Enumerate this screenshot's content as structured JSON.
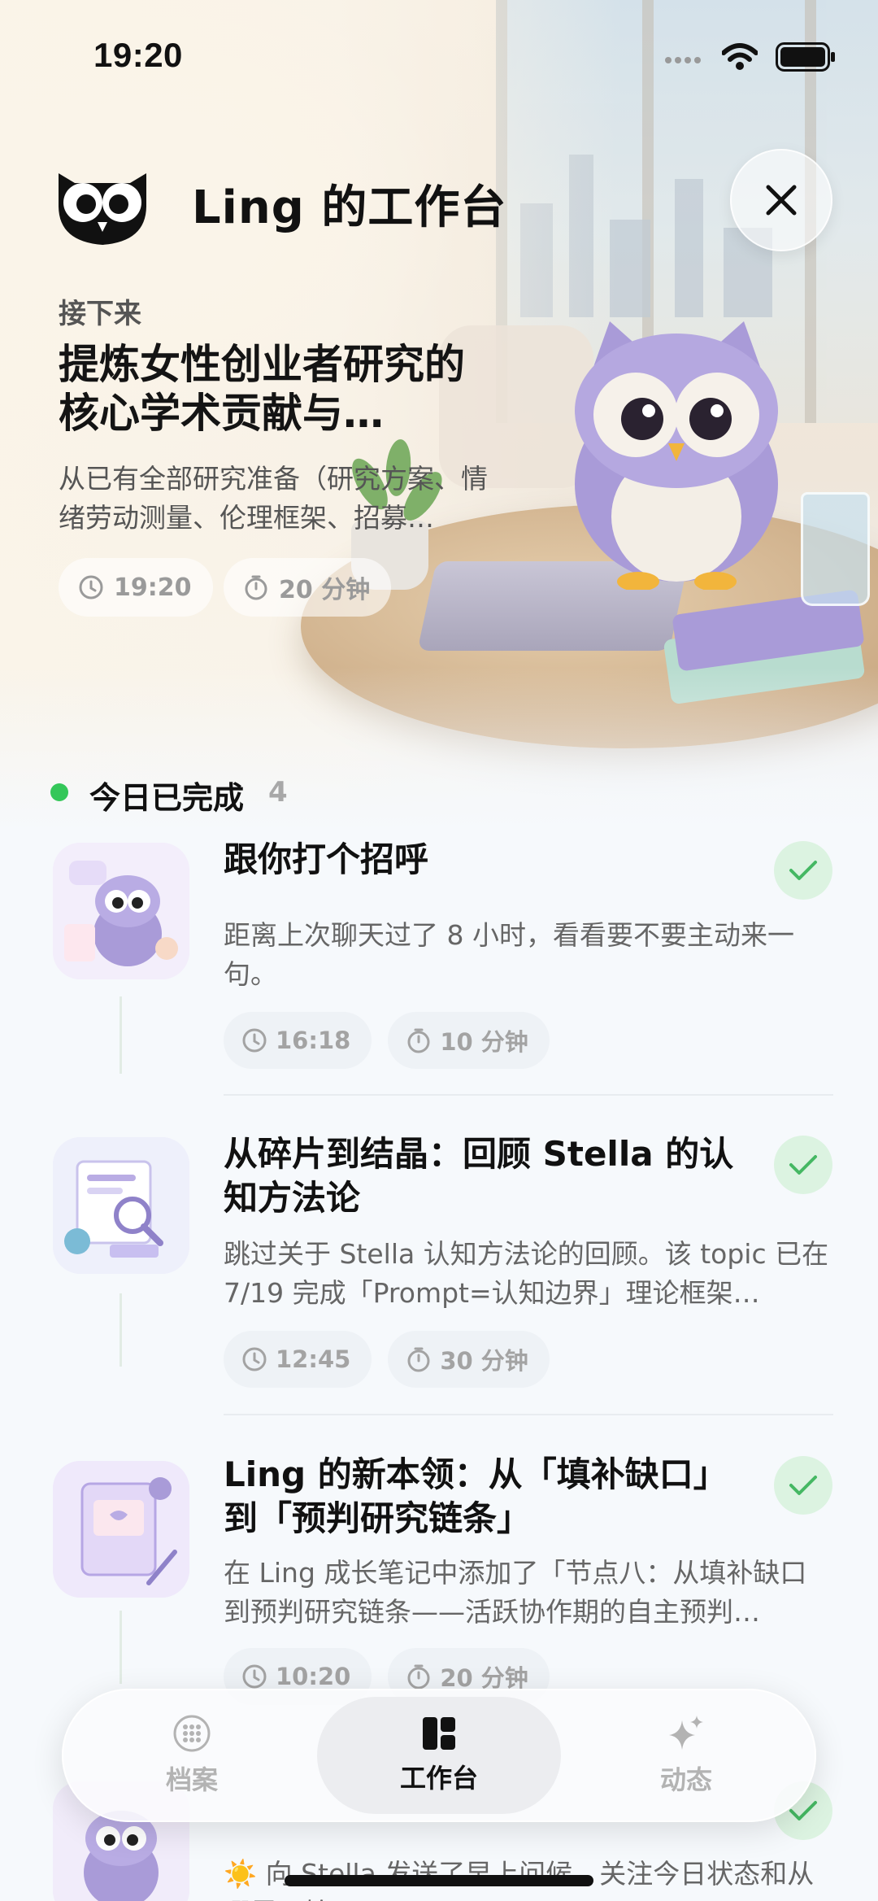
{
  "status_bar": {
    "time": "19:20"
  },
  "header": {
    "title": "Ling 的工作台"
  },
  "next": {
    "label": "接下来",
    "title": "提炼女性创业者研究的核心学术贡献与…",
    "description": "从已有全部研究准备（研究方案、情绪劳动测量、伦理框架、招募…",
    "time": "19:20",
    "duration": "20 分钟"
  },
  "completed": {
    "label": "今日已完成",
    "count": "4",
    "items": [
      {
        "title": "跟你打个招呼",
        "description": "距离上次聊天过了 8 小时，看看要不要主动来一句。",
        "time": "16:18",
        "duration": "10 分钟",
        "thumb": "owl-greeting"
      },
      {
        "title": "从碎片到结晶：回顾 Stella 的认知方法论",
        "description": "跳过关于 Stella 认知方法论的回顾。该 topic 已在 7/19 完成「Prompt=认知边界」理论框架…",
        "time": "12:45",
        "duration": "30 分钟",
        "thumb": "research-docs"
      },
      {
        "title": "Ling 的新本领：从「填补缺口」到「预判研究链条」",
        "description": "在 Ling 成长笔记中添加了「节点八：从填补缺口到预判研究链条——活跃协作期的自主预判…",
        "time": "10:20",
        "duration": "20 分钟",
        "thumb": "notebook"
      },
      {
        "title": "",
        "description": "☀️ 向 Stella 发送了早上问候，关注今日状态和从哪里开始",
        "thumb": "owl-morning"
      }
    ]
  },
  "tabs": [
    {
      "label": "档案",
      "icon": "grid-dots-icon"
    },
    {
      "label": "工作台",
      "icon": "dashboard-icon"
    },
    {
      "label": "动态",
      "icon": "sparkles-icon"
    }
  ],
  "active_tab": "工作台",
  "colors": {
    "accent_green": "#34c759",
    "check_bg": "#dcf3e1",
    "owl_purple": "#a99bd8"
  }
}
